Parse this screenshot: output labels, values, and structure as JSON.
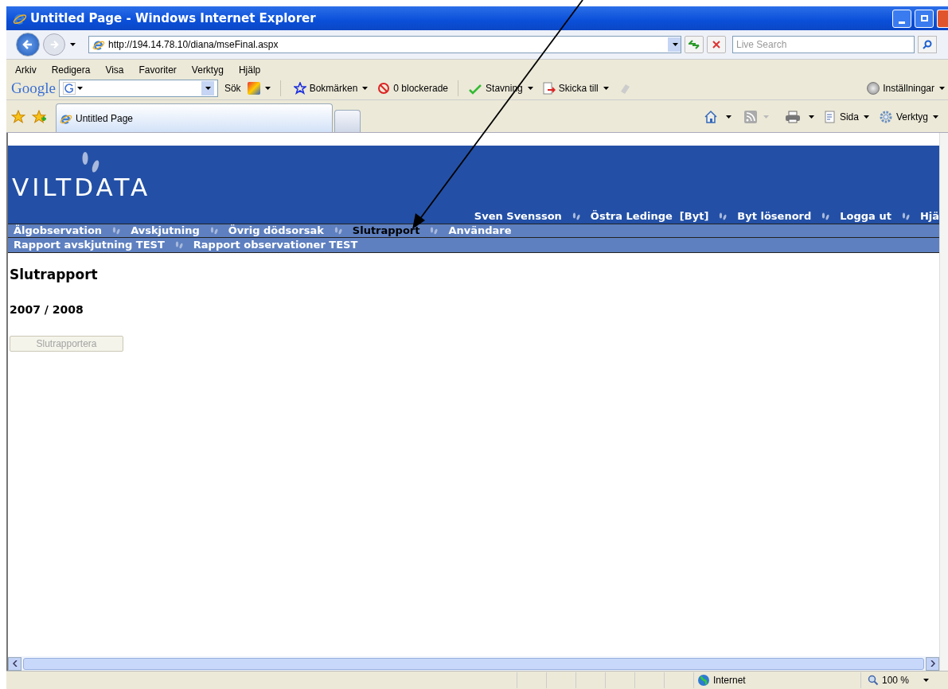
{
  "window": {
    "title": "Untitled Page - Windows Internet Explorer"
  },
  "address": {
    "url": "http://194.14.78.10/diana/mseFinal.aspx"
  },
  "search": {
    "placeholder": "Live Search"
  },
  "menu": [
    "Arkiv",
    "Redigera",
    "Visa",
    "Favoriter",
    "Verktyg",
    "Hjälp"
  ],
  "google_toolbar": {
    "logo": "Google",
    "search_button": "Sök",
    "bookmarks": "Bokmärken",
    "blocked": "0 blockerade",
    "spelling": "Stavning",
    "send": "Skicka till",
    "settings": "Inställningar"
  },
  "tab": {
    "title": "Untitled Page"
  },
  "command_bar": {
    "page": "Sida",
    "tools": "Verktyg"
  },
  "page": {
    "logo": "VILTDATA",
    "user_links": [
      "Sven Svensson",
      "Östra Ledinge  [Byt]",
      "Byt lösenord",
      "Logga ut",
      "Hjä"
    ],
    "nav": [
      {
        "label": "Älgobservation",
        "selected": false
      },
      {
        "label": "Avskjutning",
        "selected": false
      },
      {
        "label": "Övrig dödsorsak",
        "selected": false
      },
      {
        "label": "Slutrapport",
        "selected": true
      },
      {
        "label": "Användare",
        "selected": false
      }
    ],
    "subnav": [
      "Rapport avskjutning TEST",
      "Rapport observationer TEST"
    ],
    "heading": "Slutrapport",
    "season": "2007 / 2008",
    "button": {
      "label": "Slutrapportera",
      "disabled": true
    }
  },
  "status_bar": {
    "zone": "Internet",
    "zoom": "100 %"
  }
}
